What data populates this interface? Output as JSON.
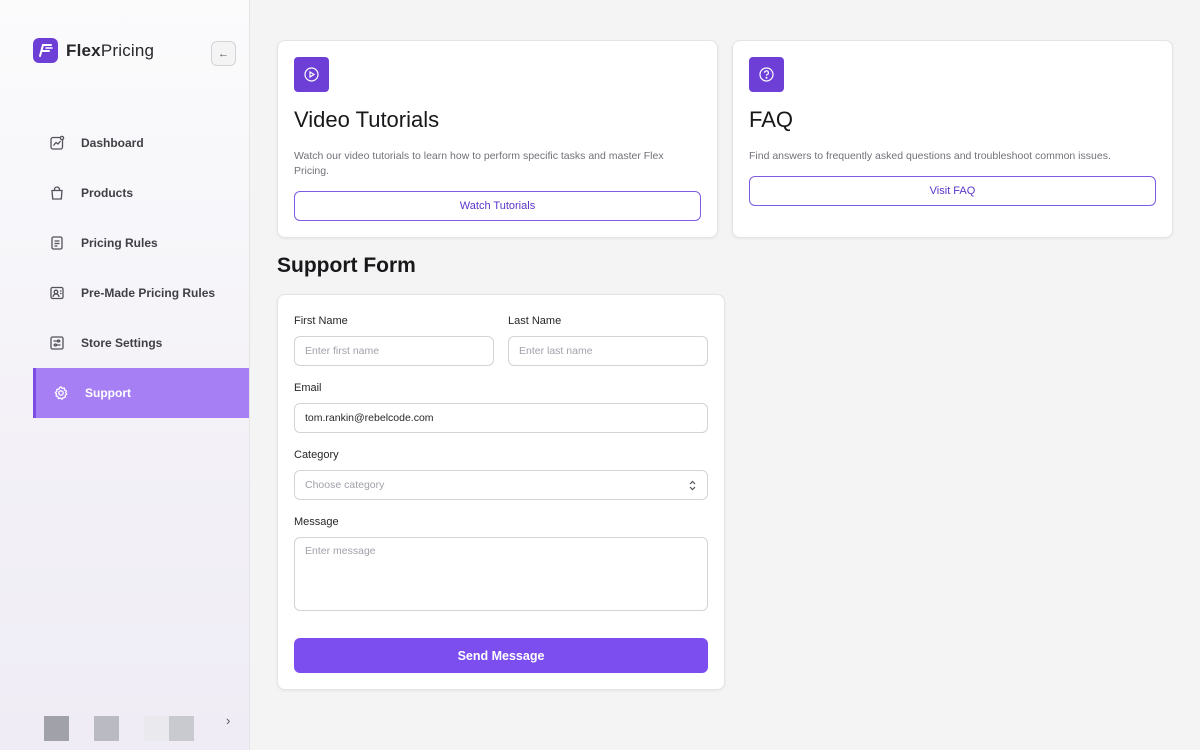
{
  "brand": {
    "name_bold": "Flex",
    "name_light": "Pricing",
    "logo_icon": "flexpricing-logo-icon"
  },
  "sidebar": {
    "collapse_icon": "arrow-left-icon",
    "items": [
      {
        "label": "Dashboard",
        "icon": "chart-icon",
        "active": false
      },
      {
        "label": "Products",
        "icon": "bag-icon",
        "active": false
      },
      {
        "label": "Pricing Rules",
        "icon": "document-icon",
        "active": false
      },
      {
        "label": "Pre-Made Pricing Rules",
        "icon": "id-card-icon",
        "active": false
      },
      {
        "label": "Store Settings",
        "icon": "sliders-icon",
        "active": false
      },
      {
        "label": "Support",
        "icon": "gear-icon",
        "active": true
      }
    ],
    "footer_arrow_icon": "chevron-right-icon",
    "footer_swatches": [
      "#a1a1aa",
      "#babac2",
      "#e4e4e7"
    ]
  },
  "cards": {
    "video": {
      "icon": "play-circle-icon",
      "title": "Video Tutorials",
      "description": "Watch our video tutorials to learn how to perform specific tasks and master Flex Pricing.",
      "button": "Watch Tutorials"
    },
    "faq": {
      "icon": "question-circle-icon",
      "title": "FAQ",
      "description": "Find answers to frequently asked questions and troubleshoot common issues.",
      "button": "Visit FAQ"
    }
  },
  "support_form": {
    "title": "Support Form",
    "first_name": {
      "label": "First Name",
      "placeholder": "Enter first name",
      "value": ""
    },
    "last_name": {
      "label": "Last Name",
      "placeholder": "Enter last name",
      "value": ""
    },
    "email": {
      "label": "Email",
      "placeholder": "",
      "value": "tom.rankin@rebelcode.com"
    },
    "category": {
      "label": "Category",
      "selected": "Choose category",
      "icon": "chevron-up-down-icon"
    },
    "message": {
      "label": "Message",
      "placeholder": "Enter message"
    },
    "submit": "Send Message"
  },
  "colors": {
    "accent": "#6d3fd6",
    "active_nav": "#a77ff5",
    "submit": "#7c4ef0"
  }
}
